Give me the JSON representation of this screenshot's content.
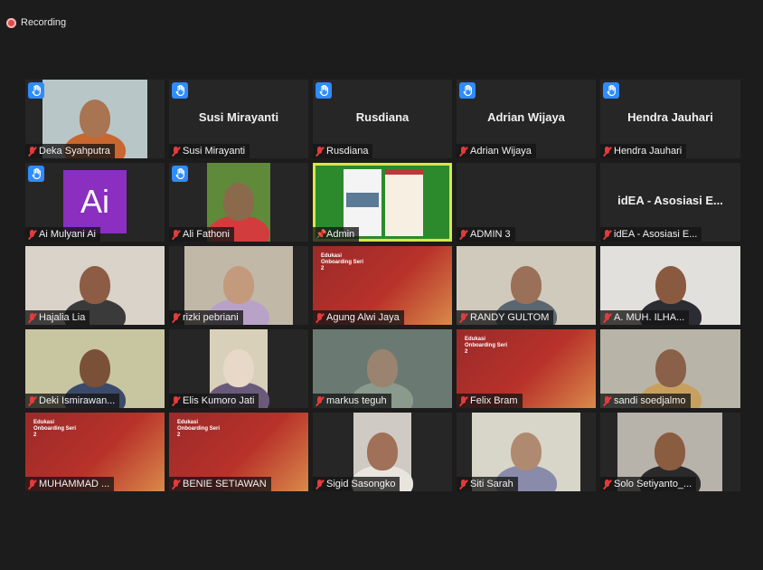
{
  "recording": {
    "label": "Recording"
  },
  "tiles": [
    {
      "name": "Deka Syahputra",
      "mode": "video",
      "hand": true,
      "bg": "#b8c6c8",
      "vx": 19,
      "vw": 116,
      "skin": "#a87452",
      "shirt": "#c8672f"
    },
    {
      "name": "Susi Mirayanti",
      "mode": "name",
      "hand": true
    },
    {
      "name": "Rusdiana",
      "mode": "name",
      "hand": true
    },
    {
      "name": "Adrian Wijaya",
      "mode": "name",
      "hand": true
    },
    {
      "name": "Hendra Jauhari",
      "mode": "name",
      "hand": true
    },
    {
      "name": "Ai Mulyani Ai",
      "mode": "ailogo",
      "hand": true,
      "logo_text": "Ai"
    },
    {
      "name": "Ali Fathoni",
      "mode": "video",
      "hand": true,
      "bg": "#5f8a3a",
      "vx": 42,
      "vw": 70,
      "skin": "#8a6a4a",
      "shirt": "#d23c3c"
    },
    {
      "name": "Admin",
      "mode": "share",
      "hand": false,
      "active": true,
      "pin": true
    },
    {
      "name": "ADMIN 3",
      "mode": "empty",
      "hand": false
    },
    {
      "name": "idEA - Asosiasi E...",
      "mode": "name",
      "hand": false
    },
    {
      "name": "Hajalia Lia",
      "mode": "video",
      "hand": false,
      "bg": "#d9d3c9",
      "vx": 0,
      "vw": 154,
      "skin": "#8c5c44",
      "shirt": "#3a3a3a"
    },
    {
      "name": "rizki pebriani",
      "mode": "video",
      "hand": false,
      "bg": "#c2b8a8",
      "vx": 17,
      "vw": 120,
      "skin": "#c49a7c",
      "shirt": "#b9a2c8"
    },
    {
      "name": "Agung Alwi Jaya",
      "mode": "slide",
      "hand": false
    },
    {
      "name": "RANDY GULTOM",
      "mode": "video",
      "hand": false,
      "bg": "#d0cabd",
      "vx": 0,
      "vw": 154,
      "skin": "#9a7058",
      "shirt": "#5a6670"
    },
    {
      "name": "A. MUH. ILHA...",
      "mode": "video",
      "hand": false,
      "bg": "#e2e0dc",
      "vx": 0,
      "vw": 155,
      "skin": "#8a5a40",
      "shirt": "#2c2c34"
    },
    {
      "name": "Deki Ismirawan...",
      "mode": "video",
      "hand": false,
      "bg": "#c8c6a0",
      "vx": 0,
      "vw": 154,
      "skin": "#7a5036",
      "shirt": "#3c4a6a"
    },
    {
      "name": "Elis Kumoro Jati",
      "mode": "video",
      "hand": false,
      "bg": "#d8d0b8",
      "vx": 45,
      "vw": 64,
      "skin": "#e8d8c8",
      "shirt": "#6a5a7a"
    },
    {
      "name": "markus teguh",
      "mode": "video",
      "hand": false,
      "bg": "#6a7a72",
      "vx": 0,
      "vw": 154,
      "skin": "#9a8470",
      "shirt": "#8a9a8c"
    },
    {
      "name": "Felix Bram",
      "mode": "slide",
      "hand": false
    },
    {
      "name": "sandi soedjalmo",
      "mode": "video",
      "hand": false,
      "bg": "#b8b4a8",
      "vx": 0,
      "vw": 155,
      "skin": "#8a6048",
      "shirt": "#c7a060"
    },
    {
      "name": "MUHAMMAD ...",
      "mode": "slide",
      "hand": false
    },
    {
      "name": "BENIE SETIAWAN",
      "mode": "slide",
      "hand": false
    },
    {
      "name": "Sigid Sasongko",
      "mode": "video",
      "hand": false,
      "bg": "#cfcac4",
      "vx": 45,
      "vw": 64,
      "skin": "#a07058",
      "shirt": "#e8e4de"
    },
    {
      "name": "Siti Sarah",
      "mode": "video",
      "hand": false,
      "bg": "#d8d6c8",
      "vx": 17,
      "vw": 120,
      "skin": "#b08a70",
      "shirt": "#8a8aaa"
    },
    {
      "name": "Solo Setiyanto_...",
      "mode": "video",
      "hand": false,
      "bg": "#b7b2aa",
      "vx": 19,
      "vw": 116,
      "skin": "#8a5c40",
      "shirt": "#2a2a2a"
    }
  ],
  "slide_text": "Edukasi Onboarding Seri 2",
  "colors": {
    "accent_hand": "#2d8cff",
    "mute_red": "#e23b3b",
    "active_border": "#d9e64a"
  }
}
